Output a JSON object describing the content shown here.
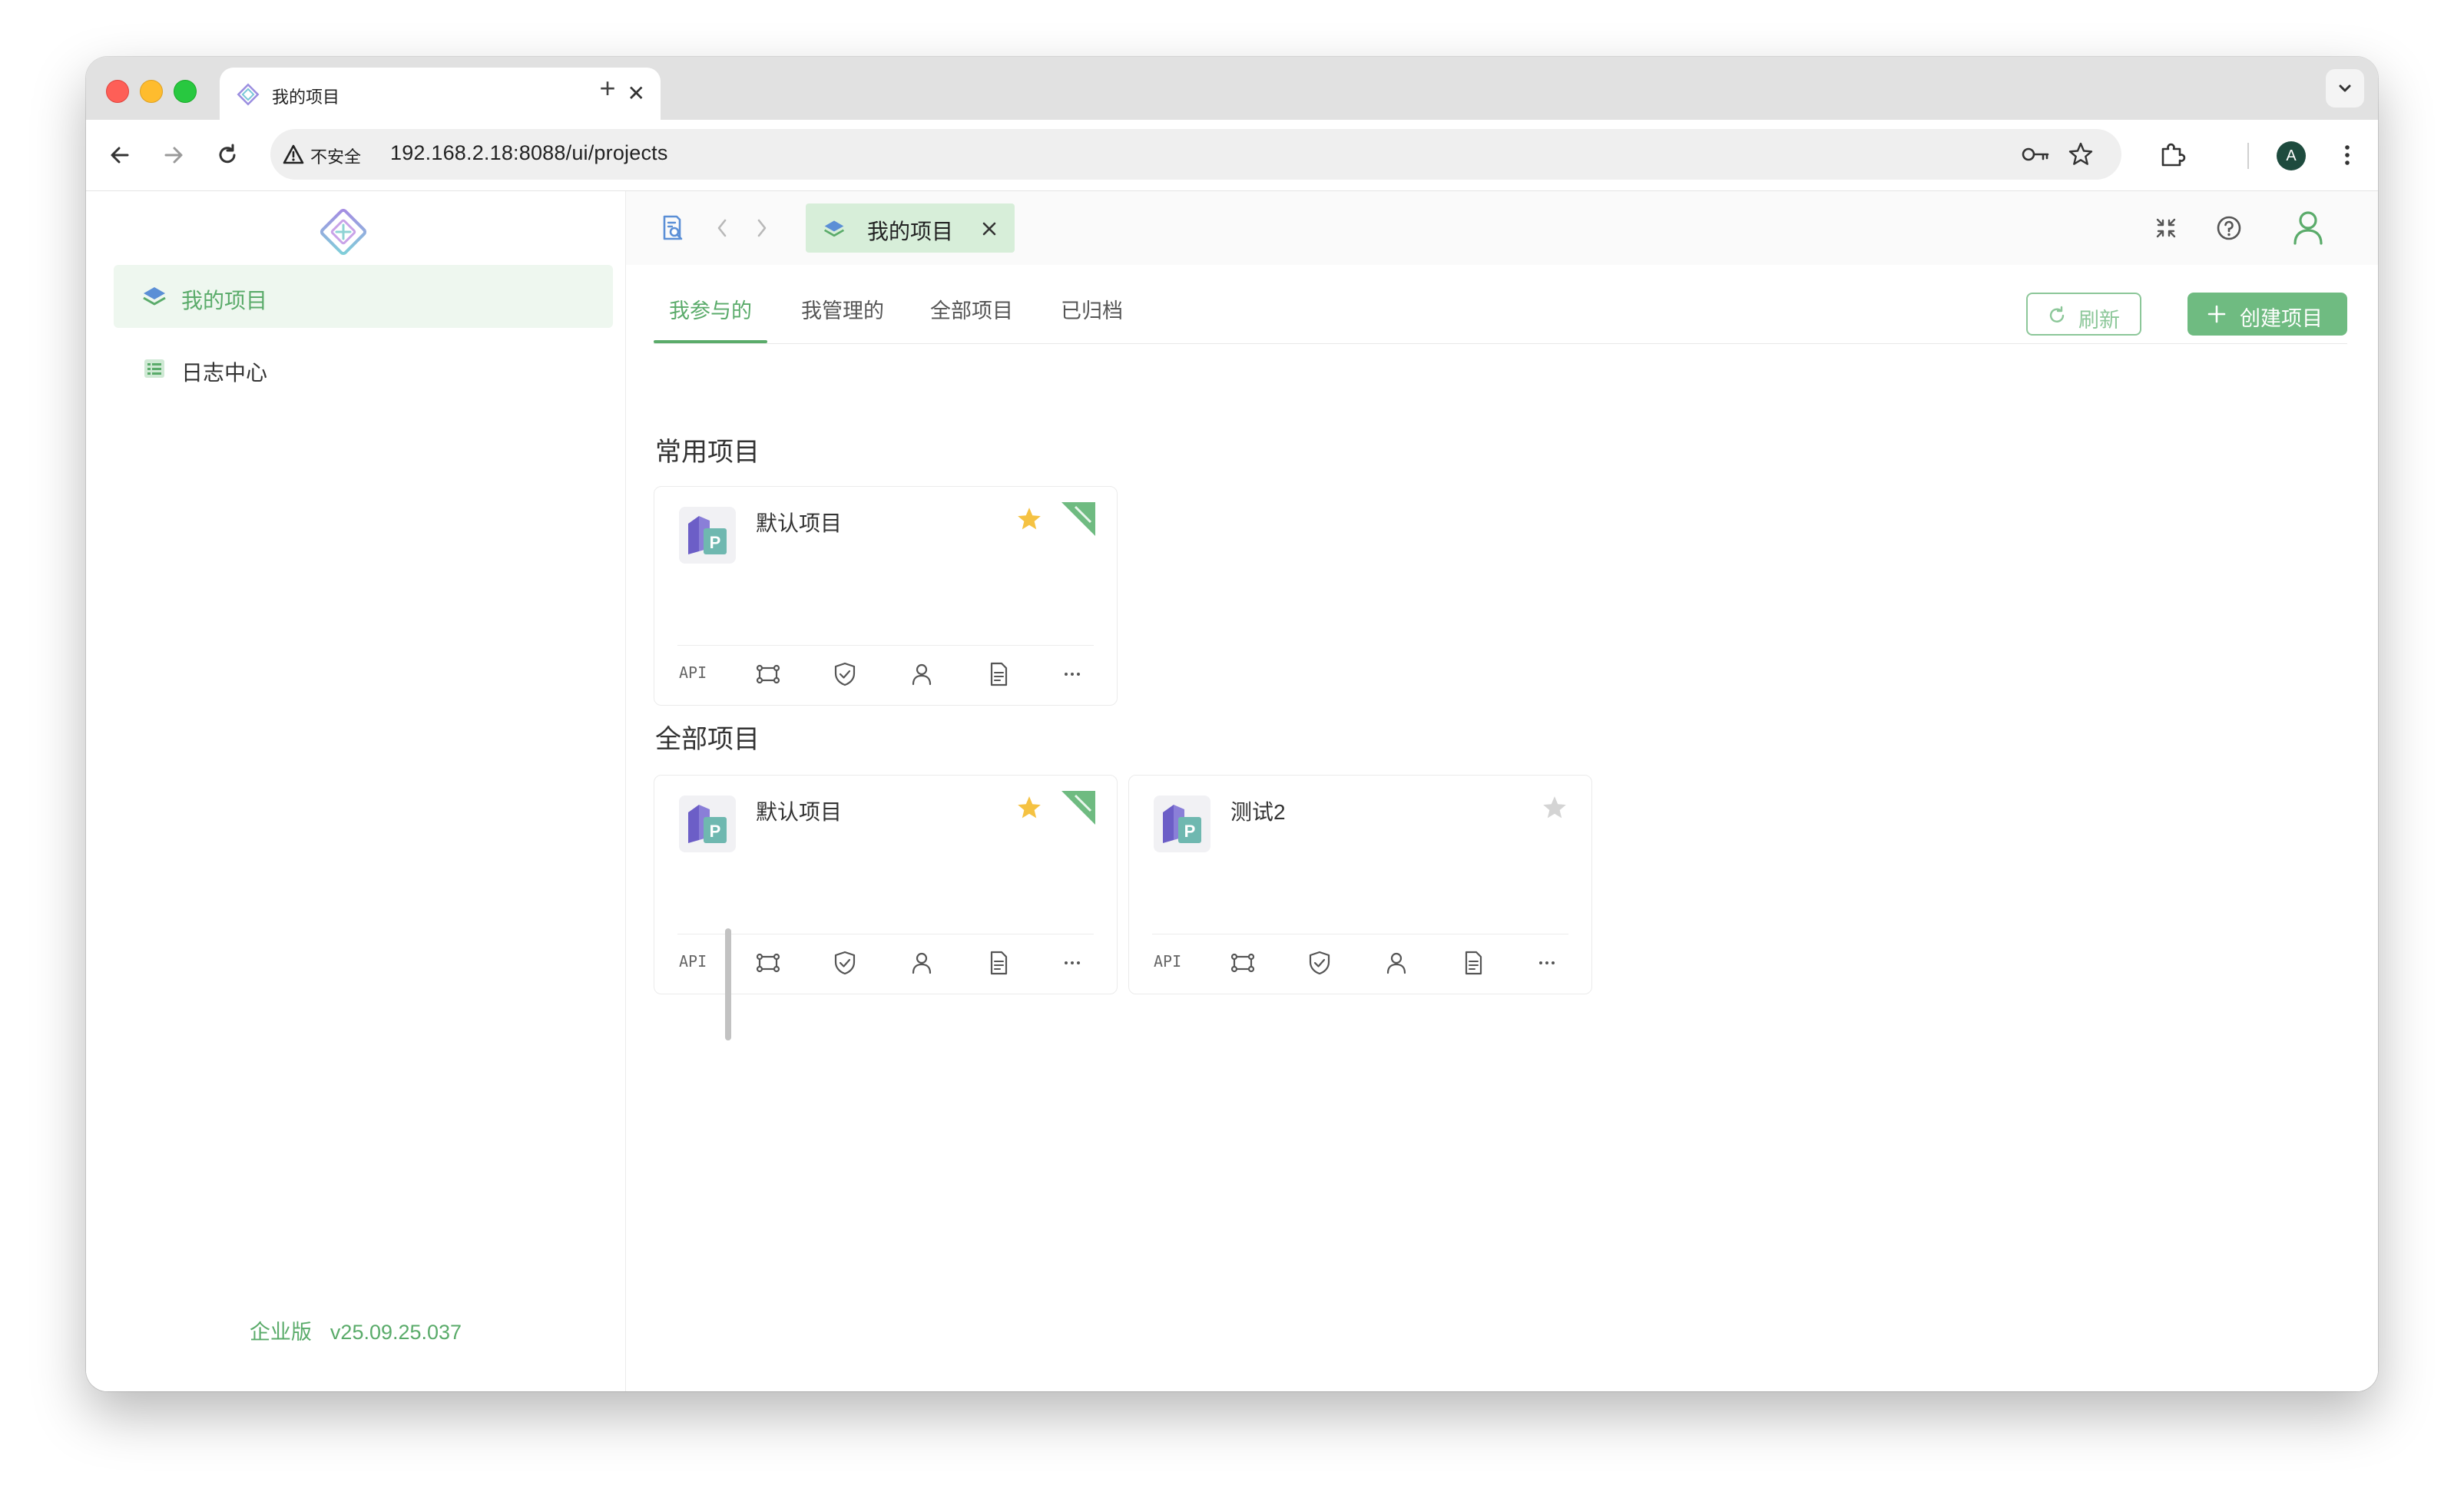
{
  "browser": {
    "tab_title": "我的项目",
    "close_glyph": "✕",
    "new_tab_glyph": "+",
    "security_label": "不安全",
    "url": "192.168.2.18:8088/ui/projects",
    "profile_initial": "A"
  },
  "sidebar": {
    "items": [
      {
        "label": "我的项目",
        "icon": "layers-icon",
        "active": true
      },
      {
        "label": "日志中心",
        "icon": "log-list-icon",
        "active": false
      }
    ],
    "edition": "企业版",
    "version": "v25.09.25.037"
  },
  "topbar": {
    "page_tab_label": "我的项目"
  },
  "subtabs": [
    {
      "label": "我参与的",
      "active": true
    },
    {
      "label": "我管理的",
      "active": false
    },
    {
      "label": "全部项目",
      "active": false
    },
    {
      "label": "已归档",
      "active": false
    }
  ],
  "actions": {
    "refresh_label": "刷新",
    "create_label": "创建项目"
  },
  "sections": {
    "frequent_title": "常用项目",
    "all_title": "全部项目"
  },
  "cards": {
    "frequent": [
      {
        "name": "默认项目",
        "starred": true,
        "default_badge": true
      }
    ],
    "all": [
      {
        "name": "默认项目",
        "starred": true,
        "default_badge": true
      },
      {
        "name": "测试2",
        "starred": false,
        "default_badge": false
      }
    ],
    "api_label": "API",
    "more_glyph": "···"
  },
  "colors": {
    "accent": "#5aab6a",
    "accent_light": "#eef7ef",
    "create_button": "#6fbb81",
    "star_on": "#f5c242",
    "star_off": "#d4d4d4"
  }
}
